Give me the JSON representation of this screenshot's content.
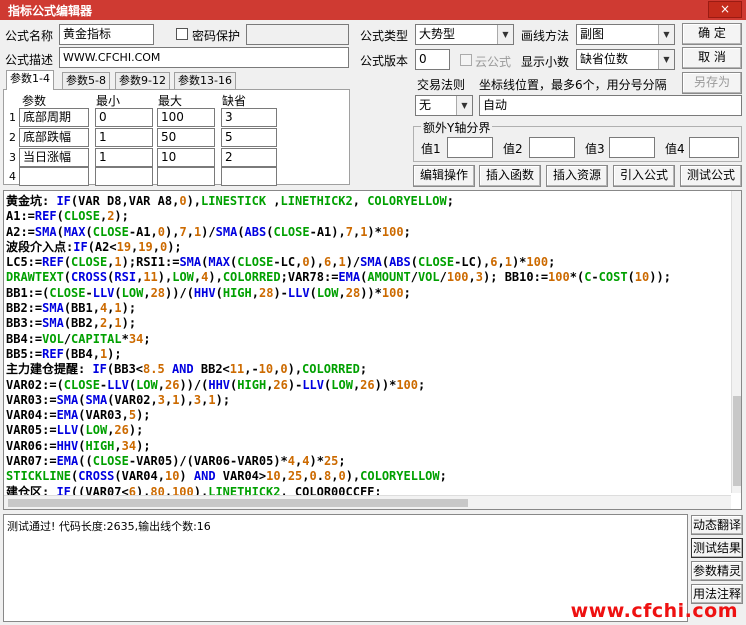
{
  "window": {
    "title": "指标公式编辑器",
    "close_label": "×"
  },
  "form": {
    "name_label": "公式名称",
    "name_value": "黄金指标",
    "password_label": "密码保护",
    "desc_label": "公式描述",
    "desc_value": "WWW.CFCHI.COM",
    "type_label": "公式类型",
    "type_value": "大势型",
    "draw_label": "画线方法",
    "draw_value": "副图",
    "version_label": "公式版本",
    "version_value": "0",
    "cloud_label": "云公式",
    "decimals_label": "显示小数",
    "decimals_value": "缺省位数",
    "trade_label": "交易法则",
    "trade_value": "无",
    "coord_label": "坐标线位置，最多6个，用分号分隔",
    "coord_value": "自动",
    "yaxis_label": "额外Y轴分界",
    "yaxis_values": [
      "值1",
      "值2",
      "值3",
      "值4"
    ]
  },
  "buttons": {
    "ok": "确  定",
    "cancel": "取  消",
    "save_as": "另存为",
    "edit_op": "编辑操作",
    "insert_func": "插入函数",
    "insert_res": "插入资源",
    "import": "引入公式",
    "test": "测试公式"
  },
  "tabs": [
    "参数1-4",
    "参数5-8",
    "参数9-12",
    "参数13-16"
  ],
  "params": {
    "headers": [
      "参数",
      "最小",
      "最大",
      "缺省"
    ],
    "rows": [
      {
        "idx": "1",
        "name": "底部周期",
        "min": "0",
        "max": "100",
        "def": "3"
      },
      {
        "idx": "2",
        "name": "底部跌幅",
        "min": "1",
        "max": "50",
        "def": "5"
      },
      {
        "idx": "3",
        "name": "当日涨幅",
        "min": "1",
        "max": "10",
        "def": "2"
      },
      {
        "idx": "4",
        "name": "",
        "min": "",
        "max": "",
        "def": ""
      }
    ]
  },
  "code_lines": [
    [
      [
        "k",
        "黄金坑: "
      ],
      [
        "b",
        "IF"
      ],
      [
        "k",
        "("
      ],
      [
        "k",
        "VAR D8"
      ],
      [
        "k",
        ","
      ],
      [
        "k",
        "VAR A8"
      ],
      [
        "k",
        ","
      ],
      [
        "r",
        "0"
      ],
      [
        "k",
        "),"
      ],
      [
        "g",
        "LINESTICK"
      ],
      [
        "k",
        " ,"
      ],
      [
        "g",
        "LINETHICK2"
      ],
      [
        "k",
        ", "
      ],
      [
        "g",
        "COLORYELLOW"
      ],
      [
        "k",
        ";"
      ]
    ],
    [
      [
        "k",
        "A1:="
      ],
      [
        "b",
        "REF"
      ],
      [
        "k",
        "("
      ],
      [
        "g",
        "CLOSE"
      ],
      [
        "k",
        ","
      ],
      [
        "r",
        "2"
      ],
      [
        "k",
        ");"
      ]
    ],
    [
      [
        "k",
        "A2:="
      ],
      [
        "b",
        "SMA"
      ],
      [
        "k",
        "("
      ],
      [
        "b",
        "MAX"
      ],
      [
        "k",
        "("
      ],
      [
        "g",
        "CLOSE"
      ],
      [
        "k",
        "-A1,"
      ],
      [
        "r",
        "0"
      ],
      [
        "k",
        "),"
      ],
      [
        "r",
        "7"
      ],
      [
        "k",
        ","
      ],
      [
        "r",
        "1"
      ],
      [
        "k",
        ")/"
      ],
      [
        "b",
        "SMA"
      ],
      [
        "k",
        "("
      ],
      [
        "b",
        "ABS"
      ],
      [
        "k",
        "("
      ],
      [
        "g",
        "CLOSE"
      ],
      [
        "k",
        "-A1),"
      ],
      [
        "r",
        "7"
      ],
      [
        "k",
        ","
      ],
      [
        "r",
        "1"
      ],
      [
        "k",
        ")*"
      ],
      [
        "r",
        "100"
      ],
      [
        "k",
        ";"
      ]
    ],
    [
      [
        "k",
        "波段介入点:"
      ],
      [
        "b",
        "IF"
      ],
      [
        "k",
        "(A2<"
      ],
      [
        "r",
        "19"
      ],
      [
        "k",
        ","
      ],
      [
        "r",
        "19"
      ],
      [
        "k",
        ","
      ],
      [
        "r",
        "0"
      ],
      [
        "k",
        ");"
      ]
    ],
    [
      [
        "k",
        "LC5:="
      ],
      [
        "b",
        "REF"
      ],
      [
        "k",
        "("
      ],
      [
        "g",
        "CLOSE"
      ],
      [
        "k",
        ","
      ],
      [
        "r",
        "1"
      ],
      [
        "k",
        ");RSI1:="
      ],
      [
        "b",
        "SMA"
      ],
      [
        "k",
        "("
      ],
      [
        "b",
        "MAX"
      ],
      [
        "k",
        "("
      ],
      [
        "g",
        "CLOSE"
      ],
      [
        "k",
        "-LC,"
      ],
      [
        "r",
        "0"
      ],
      [
        "k",
        "),"
      ],
      [
        "r",
        "6"
      ],
      [
        "k",
        ","
      ],
      [
        "r",
        "1"
      ],
      [
        "k",
        ")/"
      ],
      [
        "b",
        "SMA"
      ],
      [
        "k",
        "("
      ],
      [
        "b",
        "ABS"
      ],
      [
        "k",
        "("
      ],
      [
        "g",
        "CLOSE"
      ],
      [
        "k",
        "-LC),"
      ],
      [
        "r",
        "6"
      ],
      [
        "k",
        ","
      ],
      [
        "r",
        "1"
      ],
      [
        "k",
        ")*"
      ],
      [
        "r",
        "100"
      ],
      [
        "k",
        ";"
      ]
    ],
    [
      [
        "g",
        "DRAWTEXT"
      ],
      [
        "k",
        "("
      ],
      [
        "b",
        "CROSS"
      ],
      [
        "k",
        "("
      ],
      [
        "b",
        "RSI"
      ],
      [
        "k",
        ","
      ],
      [
        "r",
        "11"
      ],
      [
        "k",
        "),"
      ],
      [
        "g",
        "LOW"
      ],
      [
        "k",
        ","
      ],
      [
        "r",
        "4"
      ],
      [
        "k",
        "),"
      ],
      [
        "g",
        "COLORRED"
      ],
      [
        "k",
        ";VAR78:="
      ],
      [
        "b",
        "EMA"
      ],
      [
        "k",
        "("
      ],
      [
        "g",
        "AMOUNT"
      ],
      [
        "k",
        "/"
      ],
      [
        "g",
        "VOL"
      ],
      [
        "k",
        "/"
      ],
      [
        "r",
        "100"
      ],
      [
        "k",
        ","
      ],
      [
        "r",
        "3"
      ],
      [
        "k",
        "); BB10:="
      ],
      [
        "r",
        "100"
      ],
      [
        "k",
        "*("
      ],
      [
        "g",
        "C"
      ],
      [
        "k",
        "-"
      ],
      [
        "g",
        "COST"
      ],
      [
        "k",
        "("
      ],
      [
        "r",
        "10"
      ],
      [
        "k",
        "));"
      ]
    ],
    [
      [
        "k",
        "BB1:=("
      ],
      [
        "g",
        "CLOSE"
      ],
      [
        "k",
        "-"
      ],
      [
        "b",
        "LLV"
      ],
      [
        "k",
        "("
      ],
      [
        "g",
        "LOW"
      ],
      [
        "k",
        ","
      ],
      [
        "r",
        "28"
      ],
      [
        "k",
        "))/("
      ],
      [
        "b",
        "HHV"
      ],
      [
        "k",
        "("
      ],
      [
        "g",
        "HIGH"
      ],
      [
        "k",
        ","
      ],
      [
        "r",
        "28"
      ],
      [
        "k",
        ")-"
      ],
      [
        "b",
        "LLV"
      ],
      [
        "k",
        "("
      ],
      [
        "g",
        "LOW"
      ],
      [
        "k",
        ","
      ],
      [
        "r",
        "28"
      ],
      [
        "k",
        "))*"
      ],
      [
        "r",
        "100"
      ],
      [
        "k",
        ";"
      ]
    ],
    [
      [
        "k",
        "BB2:="
      ],
      [
        "b",
        "SMA"
      ],
      [
        "k",
        "(BB1,"
      ],
      [
        "r",
        "4"
      ],
      [
        "k",
        ","
      ],
      [
        "r",
        "1"
      ],
      [
        "k",
        ");"
      ]
    ],
    [
      [
        "k",
        "BB3:="
      ],
      [
        "b",
        "SMA"
      ],
      [
        "k",
        "(BB2,"
      ],
      [
        "r",
        "2"
      ],
      [
        "k",
        ","
      ],
      [
        "r",
        "1"
      ],
      [
        "k",
        ");"
      ]
    ],
    [
      [
        "k",
        "BB4:="
      ],
      [
        "g",
        "VOL"
      ],
      [
        "k",
        "/"
      ],
      [
        "g",
        "CAPITAL"
      ],
      [
        "k",
        "*"
      ],
      [
        "r",
        "34"
      ],
      [
        "k",
        ";"
      ]
    ],
    [
      [
        "k",
        "BB5:="
      ],
      [
        "b",
        "REF"
      ],
      [
        "k",
        "(BB4,"
      ],
      [
        "r",
        "1"
      ],
      [
        "k",
        ");"
      ]
    ],
    [
      [
        "k",
        "主力建仓提醒: "
      ],
      [
        "b",
        "IF"
      ],
      [
        "k",
        "(BB3<"
      ],
      [
        "r",
        "8.5"
      ],
      [
        "k",
        " "
      ],
      [
        "b",
        "AND"
      ],
      [
        "k",
        " BB2<"
      ],
      [
        "r",
        "11"
      ],
      [
        "k",
        ",-"
      ],
      [
        "r",
        "10"
      ],
      [
        "k",
        ","
      ],
      [
        "r",
        "0"
      ],
      [
        "k",
        "),"
      ],
      [
        "g",
        "COLORRED"
      ],
      [
        "k",
        ";"
      ]
    ],
    [
      [
        "k",
        "VAR02:=("
      ],
      [
        "g",
        "CLOSE"
      ],
      [
        "k",
        "-"
      ],
      [
        "b",
        "LLV"
      ],
      [
        "k",
        "("
      ],
      [
        "g",
        "LOW"
      ],
      [
        "k",
        ","
      ],
      [
        "r",
        "26"
      ],
      [
        "k",
        "))/("
      ],
      [
        "b",
        "HHV"
      ],
      [
        "k",
        "("
      ],
      [
        "g",
        "HIGH"
      ],
      [
        "k",
        ","
      ],
      [
        "r",
        "26"
      ],
      [
        "k",
        ")-"
      ],
      [
        "b",
        "LLV"
      ],
      [
        "k",
        "("
      ],
      [
        "g",
        "LOW"
      ],
      [
        "k",
        ","
      ],
      [
        "r",
        "26"
      ],
      [
        "k",
        "))*"
      ],
      [
        "r",
        "100"
      ],
      [
        "k",
        ";"
      ]
    ],
    [
      [
        "k",
        "VAR03:="
      ],
      [
        "b",
        "SMA"
      ],
      [
        "k",
        "("
      ],
      [
        "b",
        "SMA"
      ],
      [
        "k",
        "(VAR02,"
      ],
      [
        "r",
        "3"
      ],
      [
        "k",
        ","
      ],
      [
        "r",
        "1"
      ],
      [
        "k",
        "),"
      ],
      [
        "r",
        "3"
      ],
      [
        "k",
        ","
      ],
      [
        "r",
        "1"
      ],
      [
        "k",
        ");"
      ]
    ],
    [
      [
        "k",
        "VAR04:="
      ],
      [
        "b",
        "EMA"
      ],
      [
        "k",
        "(VAR03,"
      ],
      [
        "r",
        "5"
      ],
      [
        "k",
        ");"
      ]
    ],
    [
      [
        "k",
        "VAR05:="
      ],
      [
        "b",
        "LLV"
      ],
      [
        "k",
        "("
      ],
      [
        "g",
        "LOW"
      ],
      [
        "k",
        ","
      ],
      [
        "r",
        "26"
      ],
      [
        "k",
        ");"
      ]
    ],
    [
      [
        "k",
        "VAR06:="
      ],
      [
        "b",
        "HHV"
      ],
      [
        "k",
        "("
      ],
      [
        "g",
        "HIGH"
      ],
      [
        "k",
        ","
      ],
      [
        "r",
        "34"
      ],
      [
        "k",
        ");"
      ]
    ],
    [
      [
        "k",
        "VAR07:="
      ],
      [
        "b",
        "EMA"
      ],
      [
        "k",
        "(("
      ],
      [
        "g",
        "CLOSE"
      ],
      [
        "k",
        "-VAR05)/(VAR06-VAR05)*"
      ],
      [
        "r",
        "4"
      ],
      [
        "k",
        ","
      ],
      [
        "r",
        "4"
      ],
      [
        "k",
        ")*"
      ],
      [
        "r",
        "25"
      ],
      [
        "k",
        ";"
      ]
    ],
    [
      [
        "g",
        "STICKLINE"
      ],
      [
        "k",
        "("
      ],
      [
        "b",
        "CROSS"
      ],
      [
        "k",
        "(VAR04,"
      ],
      [
        "r",
        "10"
      ],
      [
        "k",
        ") "
      ],
      [
        "b",
        "AND"
      ],
      [
        "k",
        " VAR04>"
      ],
      [
        "r",
        "10"
      ],
      [
        "k",
        ","
      ],
      [
        "r",
        "25"
      ],
      [
        "k",
        ","
      ],
      [
        "r",
        "0"
      ],
      [
        "k",
        "."
      ],
      [
        "r",
        "8"
      ],
      [
        "k",
        ","
      ],
      [
        "r",
        "0"
      ],
      [
        "k",
        "),"
      ],
      [
        "g",
        "COLORYELLOW"
      ],
      [
        "k",
        ";"
      ]
    ],
    [
      [
        "k",
        "建仓区: "
      ],
      [
        "b",
        "IF"
      ],
      [
        "k",
        "((VAR07<"
      ],
      [
        "r",
        "6"
      ],
      [
        "k",
        "),"
      ],
      [
        "r",
        "80"
      ],
      [
        "k",
        ","
      ],
      [
        "r",
        "100"
      ],
      [
        "k",
        "),"
      ],
      [
        "g",
        "LINETHICK2"
      ],
      [
        "k",
        ", "
      ],
      [
        "k",
        "COLOR00CCFF"
      ],
      [
        "k",
        ";"
      ]
    ]
  ],
  "output": {
    "text": "测试通过! 代码长度:2635,输出线个数:16"
  },
  "side_buttons": [
    "动态翻译",
    "测试结果",
    "参数精灵",
    "用法注释"
  ],
  "watermark": "www.cfchi.com",
  "colors": {
    "title_bar": "#cf3a32",
    "keyword_green": "#00a000",
    "function_blue": "#0000e0",
    "number_orange": "#cc6a00",
    "watermark": "#ee1111"
  }
}
